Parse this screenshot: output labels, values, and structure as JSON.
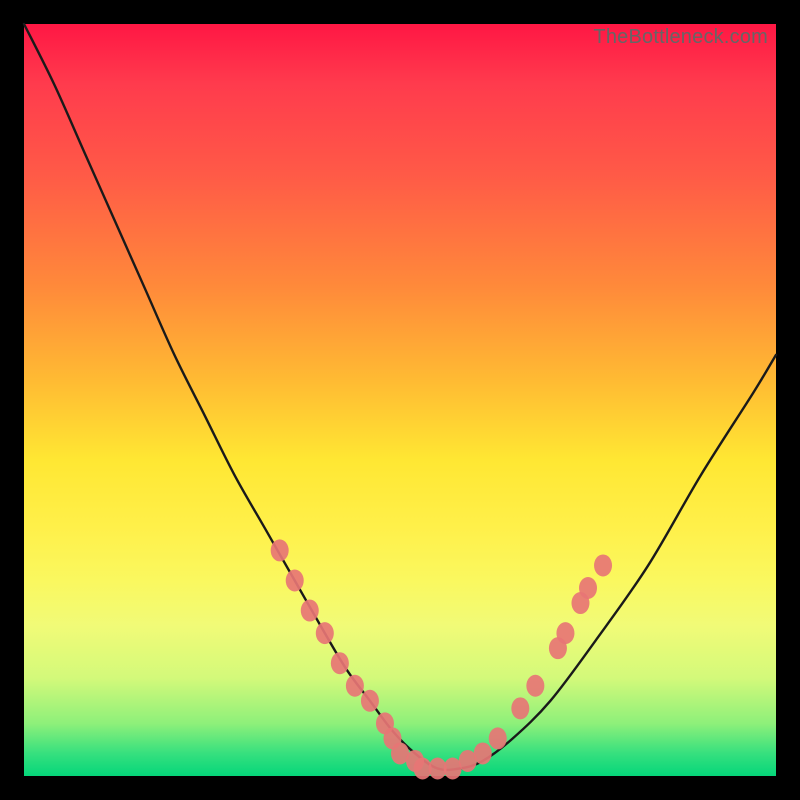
{
  "watermark": "TheBottleneck.com",
  "chart_data": {
    "type": "line",
    "title": "",
    "xlabel": "",
    "ylabel": "",
    "xlim": [
      0,
      100
    ],
    "ylim": [
      0,
      100
    ],
    "series": [
      {
        "name": "bottleneck-curve",
        "x": [
          0,
          4,
          8,
          12,
          16,
          20,
          24,
          28,
          32,
          36,
          40,
          43,
          46,
          49,
          52,
          55,
          58,
          61,
          65,
          70,
          76,
          83,
          90,
          97,
          100
        ],
        "y": [
          100,
          92,
          83,
          74,
          65,
          56,
          48,
          40,
          33,
          26,
          19,
          14,
          10,
          6,
          3,
          1,
          1,
          2,
          5,
          10,
          18,
          28,
          40,
          51,
          56
        ]
      }
    ],
    "markers": [
      {
        "x": 34,
        "y": 30
      },
      {
        "x": 36,
        "y": 26
      },
      {
        "x": 38,
        "y": 22
      },
      {
        "x": 40,
        "y": 19
      },
      {
        "x": 42,
        "y": 15
      },
      {
        "x": 44,
        "y": 12
      },
      {
        "x": 46,
        "y": 10
      },
      {
        "x": 48,
        "y": 7
      },
      {
        "x": 49,
        "y": 5
      },
      {
        "x": 50,
        "y": 3
      },
      {
        "x": 52,
        "y": 2
      },
      {
        "x": 53,
        "y": 1
      },
      {
        "x": 55,
        "y": 1
      },
      {
        "x": 57,
        "y": 1
      },
      {
        "x": 59,
        "y": 2
      },
      {
        "x": 61,
        "y": 3
      },
      {
        "x": 63,
        "y": 5
      },
      {
        "x": 66,
        "y": 9
      },
      {
        "x": 68,
        "y": 12
      },
      {
        "x": 71,
        "y": 17
      },
      {
        "x": 72,
        "y": 19
      },
      {
        "x": 74,
        "y": 23
      },
      {
        "x": 75,
        "y": 25
      },
      {
        "x": 77,
        "y": 28
      }
    ],
    "marker_color": "#e77575",
    "curve_color": "#1a1a1a"
  }
}
